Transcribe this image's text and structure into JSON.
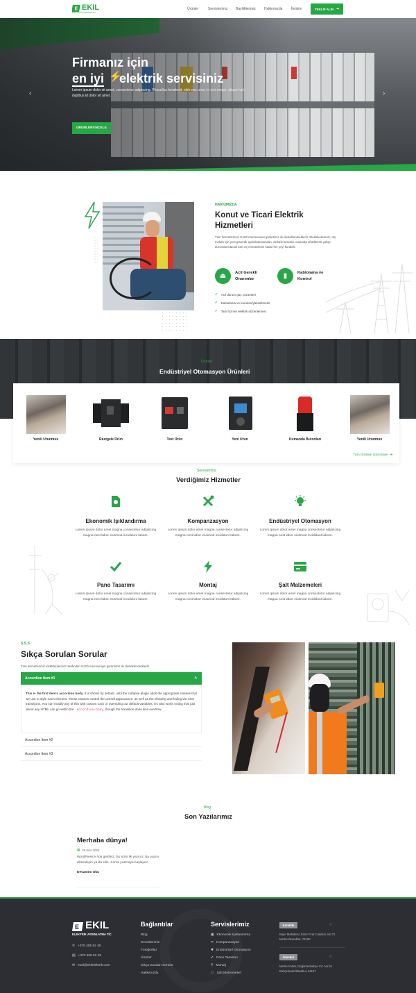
{
  "brand": {
    "name": "EKIL",
    "tagline": "ELEKTRİK AYDINLATMA TİC."
  },
  "nav": {
    "items": [
      "Ürünler",
      "Servislerimiz",
      "Bayiliklerimiz",
      "Hakkımızda",
      "İletişim"
    ],
    "quote": "TEKLİF ALIN"
  },
  "hero": {
    "line1": "Firmanız için",
    "line2a": "en iyi",
    "line2b": "elektrik servisiniz",
    "text": "Lorem ipsum dolor sit amet, consectetur adipiscing. Phasellus hendrerit, nibh nec urna. In nisi neque, aliquet vel, dapibus id dolor sit amet.",
    "button": "ÜRÜNLERİ İNCELE"
  },
  "about": {
    "tag": "HAKKIMIZDA",
    "title1": "Konut ve Ticari Elektrik",
    "title2": "Hizmetleri",
    "text": "Tüm hizmetlerimiz %100 memnuniyet garantimiz ile desteklenmektedir. Elektrikçilerimiz, dış mekan için yeni güvenlik aydınlatmasından, elektrik kesintisi ocasında ofradüresti çalışır durumda tutacak tüm ev jeneratörüne kadar her şeyi kurabilir.",
    "feat1a": "Acil Gerekli",
    "feat1b": "Onarımlar",
    "feat2a": "Kablolama ve",
    "feat2b": "Kontrol",
    "checks": [
      "Acil durum güç çözümleri",
      "Kablolama ve kurulum/yükseltmeler",
      "Tam hizmet elektrik düzenlemesi"
    ]
  },
  "products": {
    "tag": "Ürünler",
    "title": "Endüstriyel Otomasyon Ürünleri",
    "items": [
      "Yenili Urunmus",
      "Rastgele Ürün",
      "Test Ürün",
      "Yeni Urun",
      "Kumanda Butonları",
      "Yenili Urunmus"
    ],
    "all": "Tüm Ürünleri Görüntüle"
  },
  "services": {
    "tag": "Servislerimiz",
    "title": "Verdiğimiz Hizmetler",
    "desc": "Lorem ipsum dolor amet magna consectetur adipiscing magna nest labor eiusmod incididunt labore.",
    "items": [
      "Ekonomik Işıklandırma",
      "Kompanzasyon",
      "Endüstriyel Otomasyon",
      "Pano Tasarımı",
      "Montaj",
      "Şalt Malzemeleri"
    ]
  },
  "faq": {
    "tag": "S.S.S",
    "title": "Sıkça Sorulan Sorular",
    "sub": "Tüm hizmetlerimiz elektrikçilerimiz tarafından %100 memnuniyet garantimiz ile desteklenmektedir.",
    "item1": "Accordion Item #1",
    "bodyBold": "This is the first item's accordion body.",
    "body": "It is shown by default, until the collapse plugin adds the appropriate classes that we use to style each element. These classes control the overall appearance, as well as the showing and hiding via CSS transitions. You can modify any of this with custom CSS or overriding our default variables. It's also worth noting that just about any HTML can go within the",
    "code": ".accordion-body",
    "bodyEnd": ", though the transition does limit overflow.",
    "item2": "Accordion Item #2",
    "item3": "Accordion Item #3"
  },
  "blog": {
    "tag": "Blog",
    "title": "Son Yazılarımız",
    "postTitle": "Merhaba dünya!",
    "date": "26 mar 2022",
    "excerpt": "WordPress'e hoş geldiniz. Bu sizin ilk yazınız. Bu yazıyı düzenleyin ya da silin. Sonra yazmaya başlayın!",
    "more": "Devamını Oku"
  },
  "footer": {
    "phone1": "+370 405 52 45",
    "phone2": "+370 405 52 45",
    "mail": "mail@ekilelektrik.com",
    "linksTitle": "Bağlantılar",
    "links": [
      "Blog",
      "Servislerimiz",
      "Fotoğraflar",
      "Ürünler",
      "Sıkça Sorulan Sorular",
      "Hakkımızda"
    ],
    "svcTitle": "Servislerimiz",
    "svcs": [
      "Ekonomik Işıklandırma",
      "Kompanzasyon",
      "Endüstriyel Otomasyon",
      "Pano Tasarımı",
      "Montaj",
      "Şalt Malzemeleri"
    ],
    "city1": "Karabük",
    "addr1a": "Bayır Mahallesi, Emin Fırat Caddesi, No:72",
    "addr1b": "Merkez/Karabük, 78100",
    "city2": "İstanbul",
    "addr2a": "Merkezi Mah, Değirmenbahçe Cd. No:34",
    "addr2b": "Bahçelievler/İstanbul, 34197"
  },
  "colors": {
    "accent": "#27a745",
    "dark": "#2c2e33"
  }
}
